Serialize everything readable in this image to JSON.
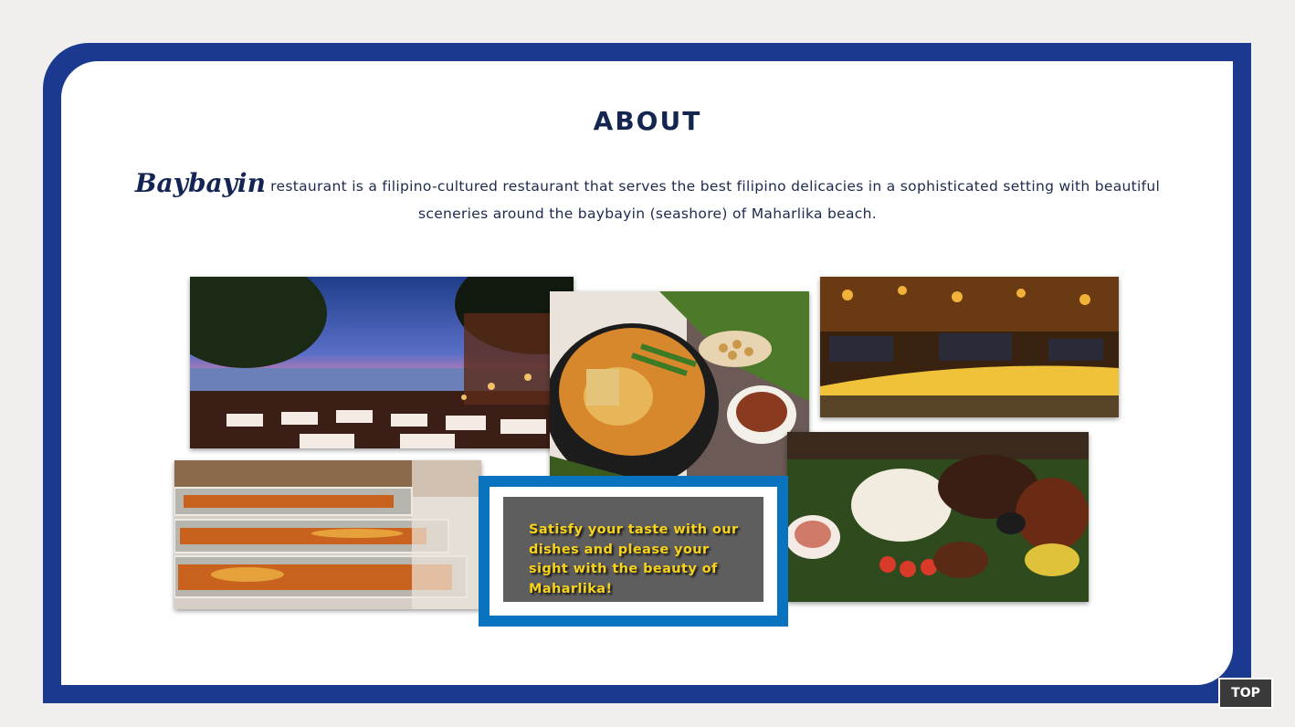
{
  "about": {
    "title": "ABOUT",
    "brand": "Baybayin",
    "description": " restaurant is a filipino-cultured restaurant that serves the best filipino delicacies in a sophisticated setting with beautiful sceneries around the baybayin (seashore) of Maharlika beach."
  },
  "gallery": {
    "caption": "Satisfy your taste with our dishes and please your sight with the beauty of Maharlika!"
  },
  "nav": {
    "top_label": "TOP"
  },
  "colors": {
    "frame": "#1b3a8f",
    "caption_border": "#0a73c0",
    "caption_text": "#f6d21c",
    "heading": "#14254f"
  }
}
